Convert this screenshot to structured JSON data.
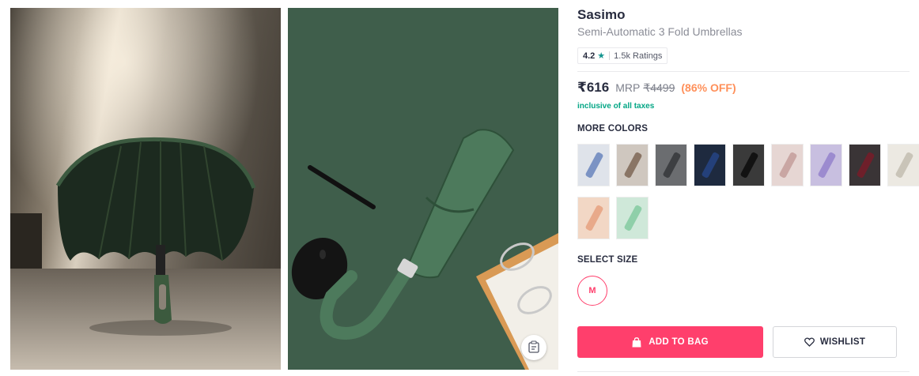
{
  "images": [
    {
      "name": "product-image-1",
      "icon": "umbrella-photo-icon"
    },
    {
      "name": "product-image-2",
      "icon": "umbrella-flatlay-photo-icon"
    }
  ],
  "similar_button": {
    "icon": "similar-products-icon"
  },
  "product": {
    "brand": "Sasimo",
    "name": "Semi-Automatic 3 Fold Umbrellas",
    "rating": "4.2",
    "rating_icon": "star-icon",
    "ratings_count": "1.5k Ratings",
    "price": "₹616",
    "mrp_label": "MRP",
    "mrp": "₹4499",
    "discount": "(86% OFF)",
    "tax_note": "inclusive of all taxes"
  },
  "colors": {
    "label": "MORE COLORS",
    "swatches": [
      {
        "name": "color-swatch-light-blue",
        "bg": "#dfe3ea",
        "accent": "#7b93c4"
      },
      {
        "name": "color-swatch-beige",
        "bg": "#cfc7bf",
        "accent": "#8a7565"
      },
      {
        "name": "color-swatch-grey",
        "bg": "#6b6d70",
        "accent": "#3d3f42"
      },
      {
        "name": "color-swatch-navy",
        "bg": "#1e2a3f",
        "accent": "#24407a"
      },
      {
        "name": "color-swatch-black",
        "bg": "#3a3a3a",
        "accent": "#121212"
      },
      {
        "name": "color-swatch-pink",
        "bg": "#e6d6d3",
        "accent": "#c9a6a3"
      },
      {
        "name": "color-swatch-lavender",
        "bg": "#c8bfe0",
        "accent": "#9c8bcf"
      },
      {
        "name": "color-swatch-maroon",
        "bg": "#3a3436",
        "accent": "#6e1f2a"
      },
      {
        "name": "color-swatch-white",
        "bg": "#ece9e2",
        "accent": "#c9c4b8"
      },
      {
        "name": "color-swatch-peach",
        "bg": "#f2d7c5",
        "accent": "#e8a98a"
      },
      {
        "name": "color-swatch-mint",
        "bg": "#cfe8d9",
        "accent": "#8fcfa9"
      }
    ]
  },
  "size": {
    "label": "SELECT SIZE",
    "options": [
      "M"
    ]
  },
  "actions": {
    "add_to_bag": "ADD TO BAG",
    "add_to_bag_icon": "shopping-bag-icon",
    "wishlist": "WISHLIST",
    "wishlist_icon": "heart-icon"
  },
  "colors_theme": {
    "accent": "#ff3f6c",
    "discount": "#ff905a",
    "tax": "#03a685",
    "rating_star": "#14958f"
  }
}
